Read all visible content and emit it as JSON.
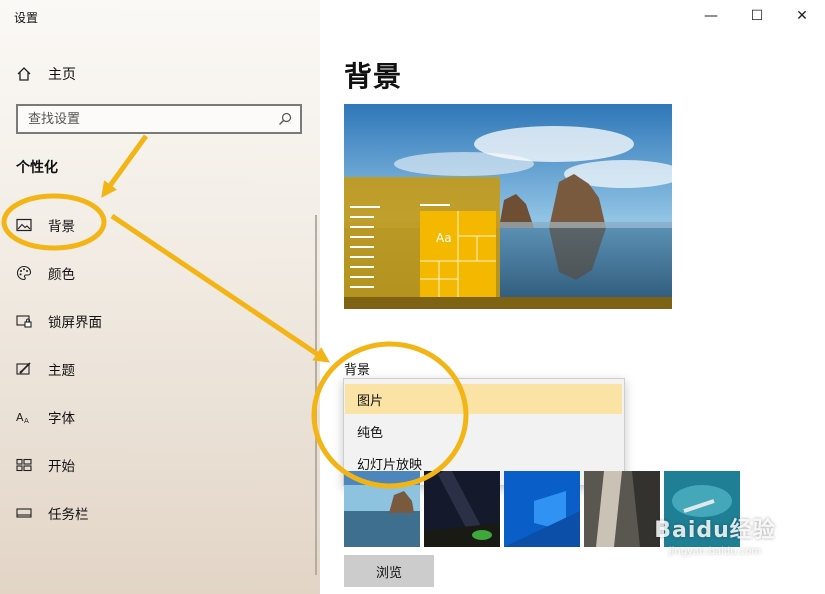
{
  "window": {
    "title": "设置",
    "controls": {
      "minimize": "—",
      "maximize": "☐",
      "close": "✕"
    }
  },
  "sidebar": {
    "home_label": "主页",
    "search": {
      "placeholder": "查找设置",
      "value": ""
    },
    "section_title": "个性化",
    "items": [
      {
        "label": "背景",
        "icon": "image-icon",
        "selected": true
      },
      {
        "label": "颜色",
        "icon": "palette-icon"
      },
      {
        "label": "锁屏界面",
        "icon": "lock-screen-icon"
      },
      {
        "label": "主题",
        "icon": "theme-brush-icon"
      },
      {
        "label": "字体",
        "icon": "font-icon"
      },
      {
        "label": "开始",
        "icon": "start-grid-icon"
      },
      {
        "label": "任务栏",
        "icon": "taskbar-icon"
      }
    ]
  },
  "main": {
    "title": "背景",
    "preview": {
      "sample_text": "Aa",
      "accent": "#f0b400"
    },
    "background_label": "背景",
    "dropdown": {
      "selected": "图片",
      "options": [
        "图片",
        "纯色",
        "幻灯片放映"
      ]
    },
    "thumbnail_count": 5,
    "browse_label": "浏览"
  },
  "watermark": {
    "line1": "Baidu经验",
    "line2": "jingyan.baidu.com"
  },
  "annotation": {
    "color": "#f2b515"
  }
}
